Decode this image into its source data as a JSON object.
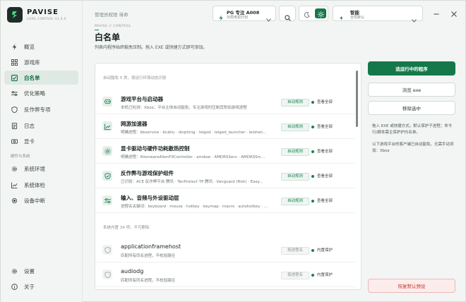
{
  "app": {
    "name": "PAVISE",
    "subtitle": "CORE CONTROL V1.0.0"
  },
  "sidebar": {
    "items": [
      {
        "label": "概览",
        "icon": "bolt-icon"
      },
      {
        "label": "游戏库",
        "icon": "grid-icon"
      },
      {
        "label": "白名单",
        "icon": "check-square-icon",
        "active": true
      },
      {
        "label": "优化策略",
        "icon": "sliders-icon"
      },
      {
        "label": "反作弊专项",
        "icon": "shield-icon"
      },
      {
        "label": "日志",
        "icon": "document-icon"
      },
      {
        "label": "显卡",
        "icon": "gpu-icon"
      }
    ],
    "section_label": "硬件与系统",
    "section_items": [
      {
        "label": "系统环境",
        "icon": "gear-icon"
      },
      {
        "label": "系统体检",
        "icon": "chart-icon"
      },
      {
        "label": "设备中断",
        "icon": "chip-icon"
      }
    ],
    "bottom_items": [
      {
        "label": "设置",
        "icon": "gear-icon"
      },
      {
        "label": "关于",
        "icon": "info-icon"
      }
    ]
  },
  "topbar": {
    "admin_status": "管理员权限 待命",
    "profile": {
      "title": "PG 专注 A008",
      "subtitle": "对局电源计划"
    },
    "mode": {
      "title": "智能",
      "subtitle": "全局默认"
    }
  },
  "page": {
    "breadcrumb": "PAVISE  //  CONTROL",
    "title": "白名单",
    "description": "列表内程序始终豁免压制。拖入 EXE 或快捷方式即可添加。"
  },
  "list": {
    "auto_header": "自动豁免 5 类，按运行环境动态识别",
    "auto_rows": [
      {
        "name": "游戏平台与启动器",
        "desc": "本机已检测：Xbox；平台主体自动豁免，专注游戏时压制其附加游戏进程",
        "tag": "自动规则",
        "status": "查看全部"
      },
      {
        "name": "网游加速器",
        "desc": "明确进程：bbservice · biubiu · doiphing · leigod · leigod_launcher · leishen...",
        "tag": "自动规则",
        "status": "查看全部"
      },
      {
        "name": "显卡驱动与硬件功耗散热控制",
        "desc": "明确进程：AlienwareAlienFXController · amdow · AMDRSServ · AMDRSSrc...",
        "tag": "自动规则",
        "status": "查看全部"
      },
      {
        "name": "反作弊与游戏保护组件",
        "desc": "已识别：ACE 反作弊平台 腾讯 · TenProtect TP 腾讯 · Vanguard (Riot) · Easy...",
        "tag": "自动规则",
        "status": "查看全部"
      },
      {
        "name": "输入、音频与外设驱动层",
        "desc": "进程名关键词：keyboard · mouse · hotkey · keymap · macro · autohotkey · ...",
        "tag": "自动规则",
        "status": "查看全部"
      }
    ],
    "system_header": "系统内置 34 项，不可删除",
    "system_rows": [
      {
        "name": "applicationframehost",
        "desc": "匹配所有同名进程，不校验路径",
        "tag": "按进程名",
        "status": "内置保护"
      },
      {
        "name": "audiodg",
        "desc": "匹配所有同名进程，不校验路径",
        "tag": "按进程名",
        "status": "内置保护"
      }
    ]
  },
  "actions": {
    "select_running": "选运行中的程序",
    "browse_exe": "浏览 exe",
    "remove_selected": "移除选中",
    "hint1": "拖入 EXE 或快捷方式。默认保护子进程；命令行/脚本需主保护护白名单。",
    "hint2": "以下游戏平台的客户端已自动豁免，无需手动添加：Xbox",
    "restore_default": "恢复默认预设"
  },
  "colors": {
    "accent": "#14784a",
    "active_bg": "#dfe9e4",
    "danger": "#c0392b",
    "dot_active": "#1a7f52",
    "dot_builtin": "#1a7f52"
  }
}
